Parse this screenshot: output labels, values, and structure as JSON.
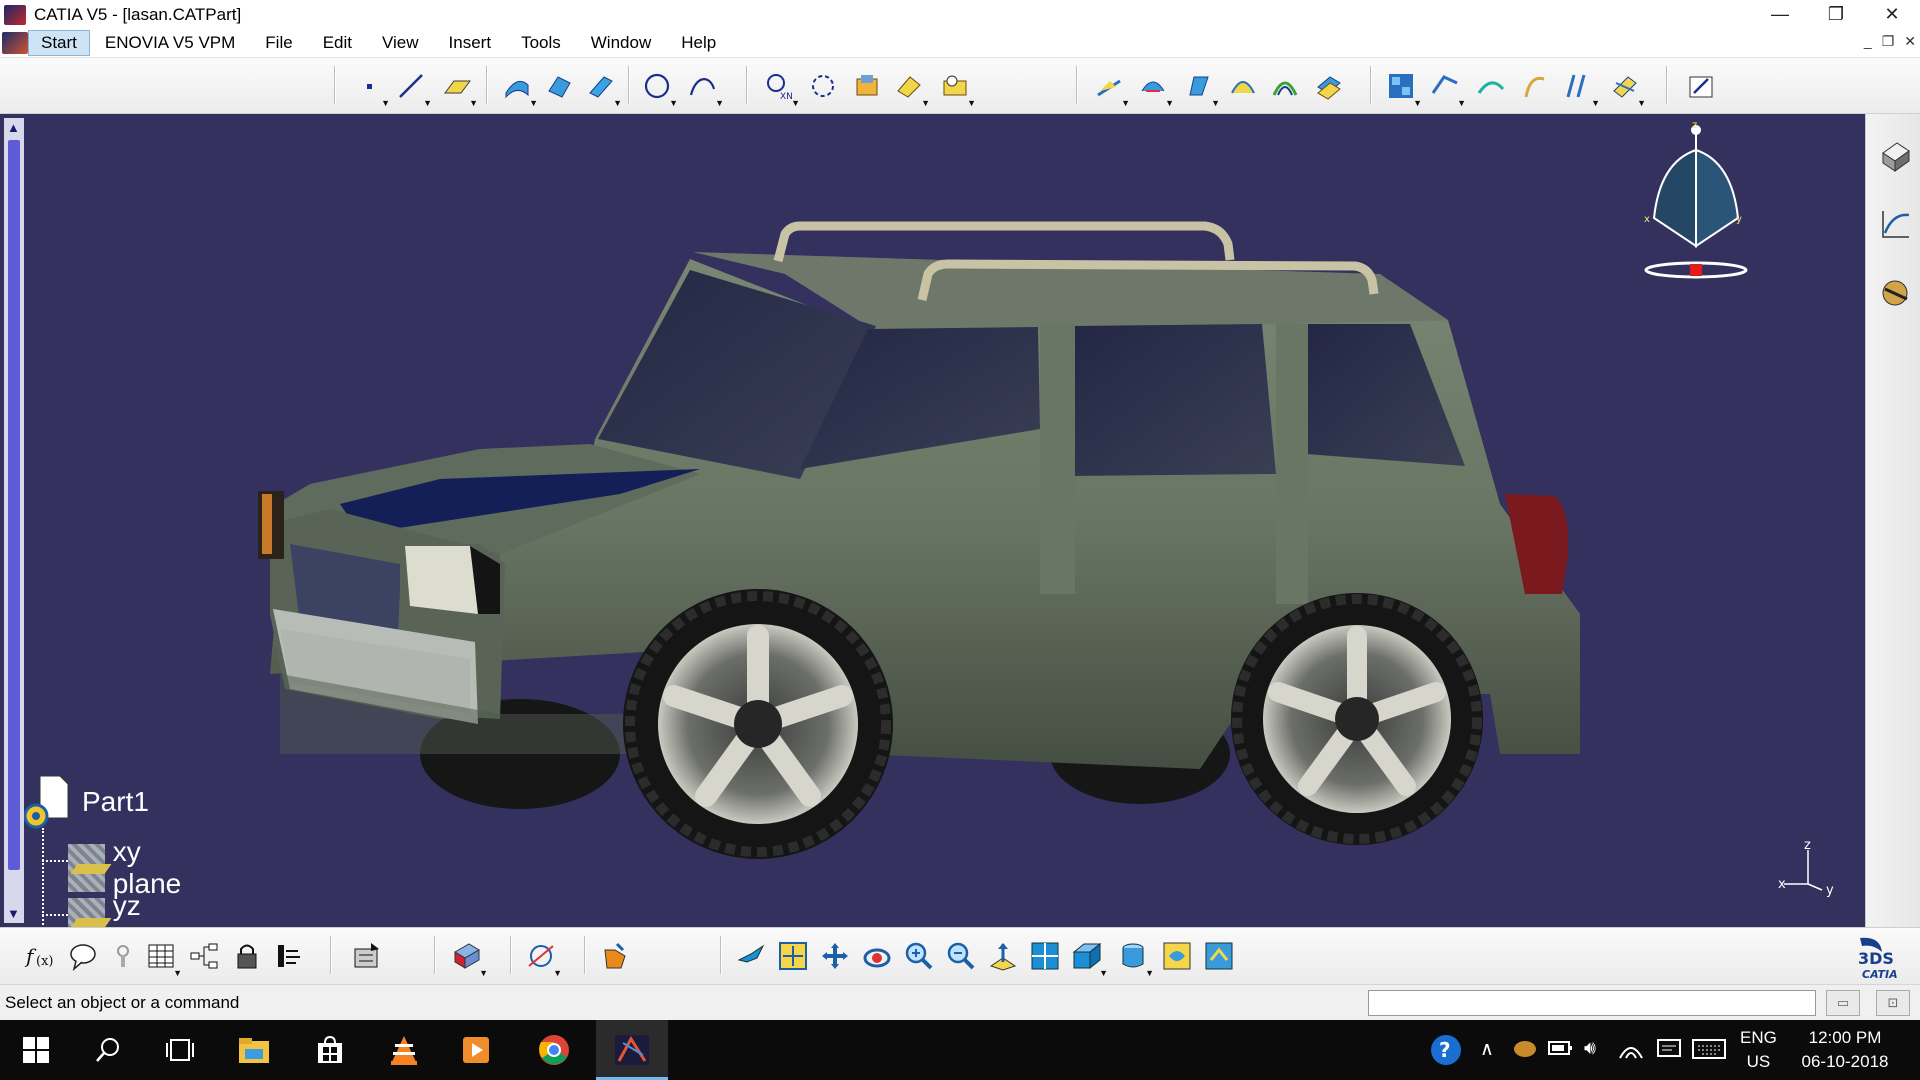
{
  "window": {
    "title": "CATIA V5 - [lasan.CATPart]",
    "controls": {
      "minimize": "—",
      "restore": "❐",
      "close": "✕"
    }
  },
  "menu": {
    "items": [
      {
        "label": "Start"
      },
      {
        "label": "ENOVIA V5 VPM"
      },
      {
        "label": "File"
      },
      {
        "label": "Edit"
      },
      {
        "label": "View"
      },
      {
        "label": "Insert"
      },
      {
        "label": "Tools"
      },
      {
        "label": "Window"
      },
      {
        "label": "Help"
      }
    ],
    "mdi_controls": {
      "minimize": "_",
      "restore": "❐",
      "close": "✕"
    }
  },
  "toolbar_top": {
    "groups": [
      [
        "point-icon",
        "line-icon",
        "plane-icon"
      ],
      [
        "extrude-surface-icon",
        "revolve-surface-icon",
        "sweep-surface-icon"
      ],
      [
        "circle-icon",
        "spline-icon"
      ],
      [
        "repetition-icon",
        "symmetry-icon",
        "join-icon",
        "healing-icon",
        "extract-icon"
      ],
      [
        "split-icon",
        "trim-icon",
        "fill-icon",
        "multi-section-icon",
        "blend-icon",
        "offset-icon"
      ],
      [
        "analysis-icon",
        "curvature-icon",
        "connect-icon",
        "boundary-icon",
        "projection-icon",
        "intersection-icon"
      ],
      [
        "sketcher-icon"
      ]
    ]
  },
  "tree": {
    "root": "Part1",
    "children": [
      {
        "label": "xy plane"
      },
      {
        "label": "yz plane"
      }
    ]
  },
  "compass_axes": {
    "z": "z",
    "x": "x",
    "y": "y"
  },
  "axis_triad": {
    "z": "z",
    "x": "x",
    "y": "y"
  },
  "status": {
    "message": "Select an object or a command",
    "command_value": ""
  },
  "logo": {
    "text": "CATIA",
    "mark": "3DS"
  },
  "taskbar": {
    "tray_lang_1": "ENG",
    "tray_lang_2": "US",
    "time": "12:00 PM",
    "date": "06-10-2018"
  },
  "colors": {
    "viewport_bg": "#34315f",
    "car_body": "#6b7566",
    "selection_blue": "#5e5bd6"
  }
}
